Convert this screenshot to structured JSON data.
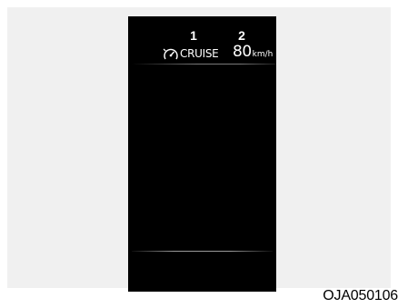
{
  "callouts": {
    "first": "1",
    "second": "2"
  },
  "cluster": {
    "cruise_label": "CRUISE",
    "set_speed": "80",
    "speed_unit": "km/h",
    "cruise_icon": "cruise-control-icon"
  },
  "figure_code": "OJA050106",
  "colors": {
    "display_background": "#000000",
    "panel_background": "#f0f0f0",
    "text": "#ffffff"
  }
}
